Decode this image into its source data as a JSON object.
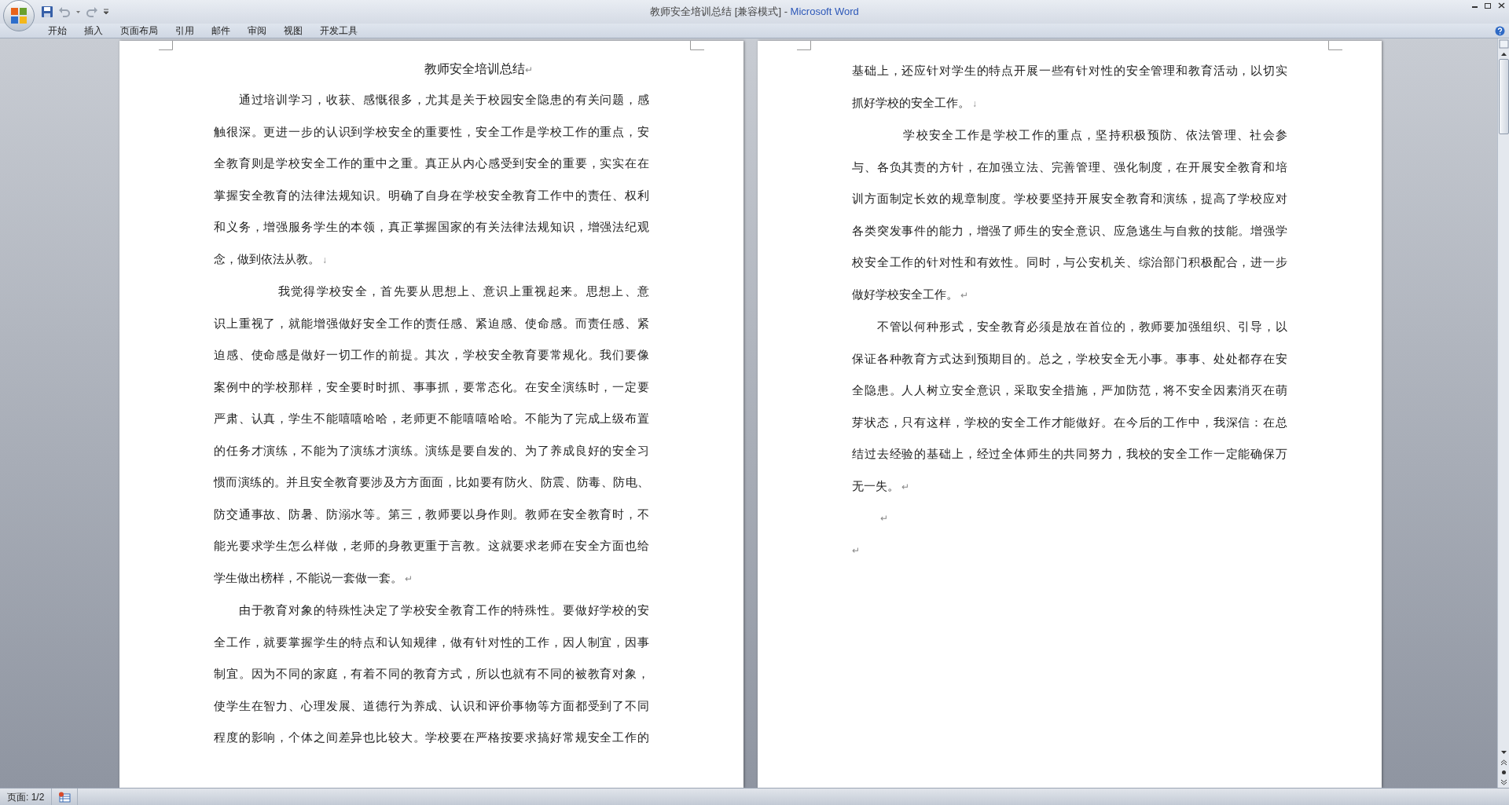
{
  "window": {
    "title": "教师安全培训总结 [兼容模式] - ",
    "app_name": "Microsoft Word"
  },
  "ribbon_tabs": [
    {
      "label": "开始"
    },
    {
      "label": "插入"
    },
    {
      "label": "页面布局"
    },
    {
      "label": "引用"
    },
    {
      "label": "邮件"
    },
    {
      "label": "审阅"
    },
    {
      "label": "视图"
    },
    {
      "label": "开发工具"
    }
  ],
  "pages": [
    {
      "title": {
        "text": "教师安全培训总结",
        "end_mark": "↵"
      },
      "paragraphs": [
        {
          "end_mark": "↓",
          "lines": [
            "　　通过培训学习，收获、感慨很多，尤其是关于校园安全隐患的有关问题，感",
            "触很深。更进一步的认识到学校安全的重要性，安全工作是学校工作的重点，安",
            "全教育则是学校安全工作的重中之重。真正从内心感受到安全的重要，实实在在",
            "掌握安全教育的法律法规知识。明确了自身在学校安全教育工作中的责任、权利",
            "和义务，增强服务学生的本领，真正掌握国家的有关法律法规知识，增强法纪观",
            "念，做到依法从教。"
          ]
        },
        {
          "end_mark": "↵",
          "lines": [
            "　　　　　我觉得学校安全，首先要从思想上、意识上重视起来。思想上、意",
            "识上重视了，就能增强做好安全工作的责任感、紧迫感、使命感。而责任感、紧",
            "迫感、使命感是做好一切工作的前提。其次，学校安全教育要常规化。我们要像",
            "案例中的学校那样，安全要时时抓、事事抓，要常态化。在安全演练时，一定要",
            "严肃、认真，学生不能嘻嘻哈哈，老师更不能嘻嘻哈哈。不能为了完成上级布置",
            "的任务才演练，不能为了演练才演练。演练是要自发的、为了养成良好的安全习",
            "惯而演练的。并且安全教育要涉及方方面面，比如要有防火、防震、防毒、防电、",
            "防交通事故、防暑、防溺水等。第三，教师要以身作则。教师在安全教育时，不",
            "能光要求学生怎么样做，老师的身教更重于言教。这就要求老师在安全方面也给",
            "学生做出榜样，不能说一套做一套。"
          ]
        },
        {
          "lines": [
            "　　由于教育对象的特殊性决定了学校安全教育工作的特殊性。要做好学校的安",
            "全工作，就要掌握学生的特点和认知规律，做有针对性的工作，因人制宜，因事",
            "制宜。因为不同的家庭，有着不同的教育方式，所以也就有不同的被教育对象，",
            "使学生在智力、心理发展、道德行为养成、认识和评价事物等方面都受到了不同",
            "程度的影响，个体之间差异也比较大。学校要在严格按要求搞好常规安全工作的"
          ]
        }
      ]
    },
    {
      "paragraphs": [
        {
          "end_mark": "↓",
          "lines": [
            "基础上，还应针对学生的特点开展一些有针对性的安全管理和教育活动，以切实",
            "抓好学校的安全工作。"
          ]
        },
        {
          "end_mark": "↵",
          "lines": [
            "　　　　学校安全工作是学校工作的重点，坚持积极预防、依法管理、社会参",
            "与、各负其责的方针，在加强立法、完善管理、强化制度，在开展安全教育和培",
            "训方面制定长效的规章制度。学校要坚持开展安全教育和演练，提高了学校应对",
            "各类突发事件的能力，增强了师生的安全意识、应急逃生与自救的技能。增强学",
            "校安全工作的针对性和有效性。同时，与公安机关、综治部门积极配合，进一步",
            "做好学校安全工作。"
          ]
        },
        {
          "end_mark": "↵",
          "lines": [
            "　　不管以何种形式，安全教育必须是放在首位的，教师要加强组织、引导，以",
            "保证各种教育方式达到预期目的。总之，学校安全无小事。事事、处处都存在安",
            "全隐患。人人树立安全意识，采取安全措施，严加防范，将不安全因素消灭在萌",
            "芽状态，只有这样，学校的安全工作才能做好。在今后的工作中，我深信：在总",
            "结过去经验的基础上，经过全体师生的共同努力，我校的安全工作一定能确保万",
            "无一失。"
          ]
        },
        {
          "end_mark": "　　　↵"
        },
        {
          "end_mark": "↵"
        }
      ]
    }
  ],
  "status_bar": {
    "page": "页面: 1/2"
  }
}
